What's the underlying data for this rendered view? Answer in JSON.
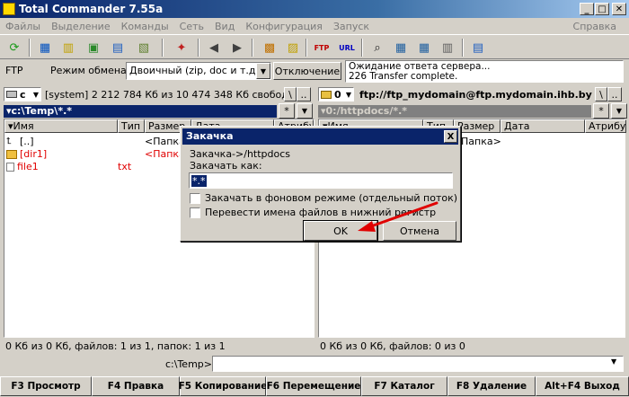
{
  "window": {
    "title": "Total Commander 7.55a",
    "min": "_",
    "max": "□",
    "close": "✕"
  },
  "menu": [
    "Файлы",
    "Выделение",
    "Команды",
    "Сеть",
    "Вид",
    "Конфигурация",
    "Запуск"
  ],
  "menu_help": "Справка",
  "ftp_bar": {
    "label": "FTP",
    "mode_label": "Режим обмена",
    "mode_value": "Двоичный (zip, doc и т.д.)",
    "disconnect": "Отключение",
    "log_line1": "Ожидание ответа сервера...",
    "log_line2": "226 Transfer complete."
  },
  "left": {
    "drive": "c",
    "drive_info": "[system]  2 212 784 Кб из 10 474 348 Кб свобод",
    "path": "c:\\Temp\\*.*",
    "columns": [
      "Имя",
      "Тип",
      "Размер",
      "Дата",
      "Атрибут"
    ],
    "rows": [
      {
        "name": "[..]",
        "type": "",
        "size": "<Папка>",
        "color": "#000000"
      },
      {
        "name": "[dir1]",
        "type": "",
        "size": "<Папка>",
        "color": "#e00000"
      },
      {
        "name": "file1",
        "type": "txt",
        "size": "",
        "color": "#e00000"
      }
    ],
    "status": "0 Кб из 0 Кб, файлов: 1 из 1, папок: 1 из 1"
  },
  "right": {
    "drive": "0",
    "drive_info": "ftp://ftp_mydomain@ftp.mydomain.ihb.by",
    "path": "0:/httpdocs/*.*",
    "columns": [
      "Имя",
      "Тип",
      "Размер",
      "Дата",
      "Атрибут"
    ],
    "rows": [
      {
        "name": "",
        "type": "",
        "size": "Папка>"
      }
    ],
    "status": "0 Кб из 0 Кб, файлов: 0 из 0"
  },
  "dialog": {
    "title": "Закачка",
    "close": "X",
    "line1": "Закачка->/httpdocs",
    "line2": "Закачать как:",
    "input_value": "*.*",
    "chk1": "Закачать в фоновом режиме (отдельный поток)",
    "chk2": "Перевести имена файлов в нижний регистр",
    "ok": "OK",
    "cancel": "Отмена"
  },
  "cmdline": {
    "path": "c:\\Temp>",
    "value": ""
  },
  "fkeys": [
    "F3 Просмотр",
    "F4 Правка",
    "F5 Копирование",
    "F6 Перемещение",
    "F7 Каталог",
    "F8 Удаление",
    "Alt+F4 Выход"
  ],
  "colors": {
    "title_active": "#0a246a",
    "arrow": "#e00000"
  }
}
